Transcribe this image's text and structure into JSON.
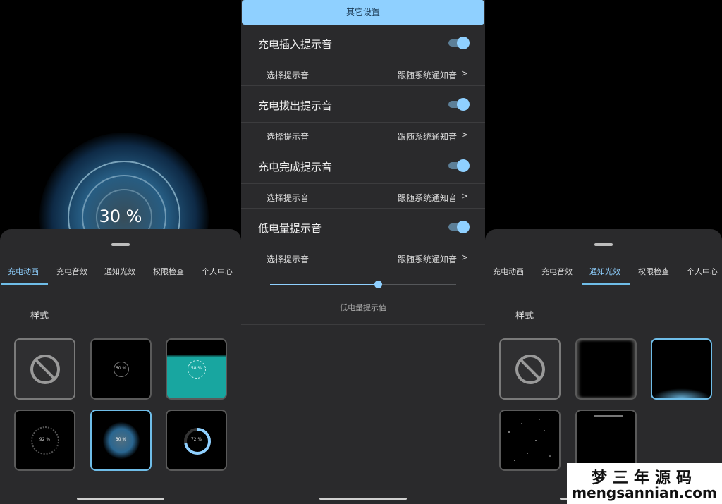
{
  "left_panel": {
    "percent_display": "30 %",
    "tabs": [
      {
        "label": "充电动画",
        "active": true
      },
      {
        "label": "充电音效",
        "active": false
      },
      {
        "label": "通知光效",
        "active": false
      },
      {
        "label": "权限检查",
        "active": false
      },
      {
        "label": "个人中心",
        "active": false
      }
    ],
    "section_label": "样式",
    "thumbnails": [
      {
        "icon": "no-entry-icon",
        "text": ""
      },
      {
        "icon": "ring-animation-icon",
        "text": "60 %"
      },
      {
        "icon": "wave-animation-icon",
        "text": "58 %"
      },
      {
        "icon": "dotted-ring-animation-icon",
        "text": "92 %"
      },
      {
        "icon": "glow-ring-animation-icon",
        "text": "30 %",
        "selected": true
      },
      {
        "icon": "progress-ring-animation-icon",
        "text": "72 %"
      }
    ]
  },
  "settings_panel": {
    "title": "其它设置",
    "rows": [
      {
        "label": "充电插入提示音",
        "enabled": true,
        "sub_label": "选择提示音",
        "sub_value": "跟随系统通知音"
      },
      {
        "label": "充电拔出提示音",
        "enabled": true,
        "sub_label": "选择提示音",
        "sub_value": "跟随系统通知音"
      },
      {
        "label": "充电完成提示音",
        "enabled": true,
        "sub_label": "选择提示音",
        "sub_value": "跟随系统通知音"
      },
      {
        "label": "低电量提示音",
        "enabled": true,
        "sub_label": "选择提示音",
        "sub_value": "跟随系统通知音"
      }
    ],
    "chevron": ">",
    "slider_caption": "低电量提示值",
    "slider_level": 0.58
  },
  "right_panel": {
    "tabs": [
      {
        "label": "充电动画",
        "active": false
      },
      {
        "label": "充电音效",
        "active": false
      },
      {
        "label": "通知光效",
        "active": true
      },
      {
        "label": "权限检查",
        "active": false
      },
      {
        "label": "个人中心",
        "active": false
      }
    ],
    "section_label": "样式",
    "thumbnails": [
      {
        "icon": "no-entry-icon"
      },
      {
        "icon": "edge-light-icon"
      },
      {
        "icon": "bottom-glow-icon",
        "selected": true
      },
      {
        "icon": "starfield-icon"
      },
      {
        "icon": "top-line-icon"
      }
    ]
  },
  "watermark": {
    "chinese": "梦三年源码",
    "domain": "mengsannian.com"
  },
  "colors": {
    "accent": "#8fd0ff",
    "sheet_bg": "#2a2a2c",
    "underline": "#6fbde8"
  }
}
